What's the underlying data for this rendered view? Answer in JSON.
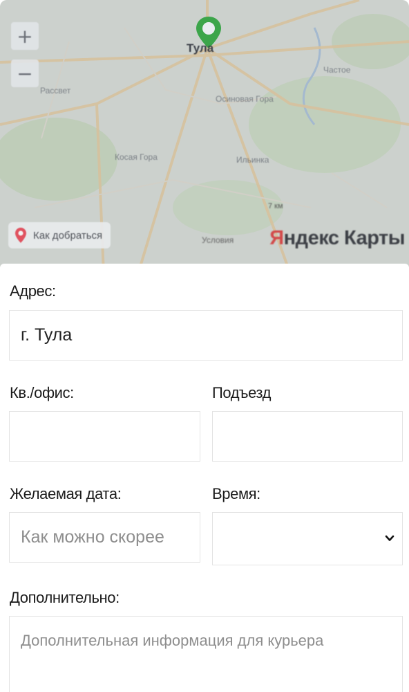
{
  "map": {
    "city_label": "Тула",
    "zoom_in": "+",
    "zoom_out": "−",
    "route_button": "Как добраться",
    "brand_prefix": "Я",
    "brand_rest": "ндекс Карты",
    "scale_text": "7 км",
    "terms_text": "Условия",
    "place_labels": [
      "Рассвет",
      "Частое",
      "Осиновая Гора",
      "Косая Гора",
      "Ильинка"
    ]
  },
  "form": {
    "address_label": "Адрес:",
    "address_value": "г. Тула",
    "apartment_label": "Кв./офис:",
    "apartment_value": "",
    "entrance_label": "Подъезд",
    "entrance_value": "",
    "date_label": "Желаемая дата:",
    "date_placeholder": "Как можно скорее",
    "time_label": "Время:",
    "time_value": "",
    "extra_label": "Дополнительно:",
    "extra_placeholder": "Дополнительная информация для курьера"
  }
}
